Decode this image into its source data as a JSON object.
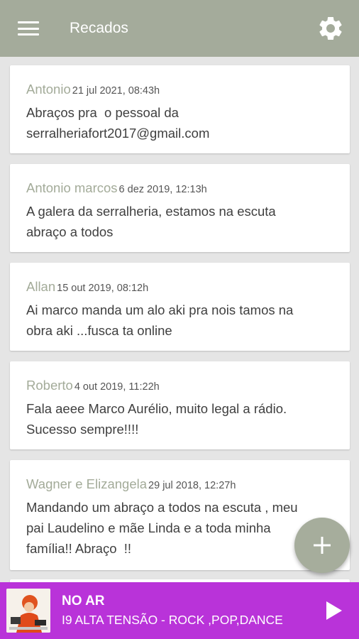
{
  "app": {
    "title": "Recados"
  },
  "messages": [
    {
      "author": "Antonio",
      "date": "21 jul 2021, 08:43h",
      "text": "Abraços pra  o pessoal da\nserralheriafort2017@gmail.com"
    },
    {
      "author": "Antonio marcos",
      "date": "6 dez 2019, 12:13h",
      "text": "A galera da serralheria, estamos na escuta\nabraço a todos"
    },
    {
      "author": "Allan",
      "date": "15 out 2019, 08:12h",
      "text": "Ai marco manda um alo aki pra nois tamos na\nobra aki ...fusca ta online"
    },
    {
      "author": "Roberto",
      "date": "4 out 2019, 11:22h",
      "text": "Fala aeee Marco Aurélio, muito legal a rádio.\nSucesso sempre!!!!"
    },
    {
      "author": "Wagner e Elizangela",
      "date": "29 jul 2018, 12:27h",
      "text": "Mandando um abraço a todos na escuta , meu\npai Laudelino e mãe Linda e a toda minha\nfamília!! Abraço  !!"
    }
  ],
  "player": {
    "status": "NO AR",
    "track": "I9 ALTA TENSÃO - ROCK ,POP,DANCE"
  },
  "colors": {
    "toolbar": "#a4ab9b",
    "author": "#a3ab99",
    "player": "#b933d9",
    "fab": "#a6ad9c"
  },
  "icons": {
    "menu": "hamburger-icon",
    "settings": "gear-icon",
    "add": "plus-icon",
    "play": "play-icon"
  }
}
